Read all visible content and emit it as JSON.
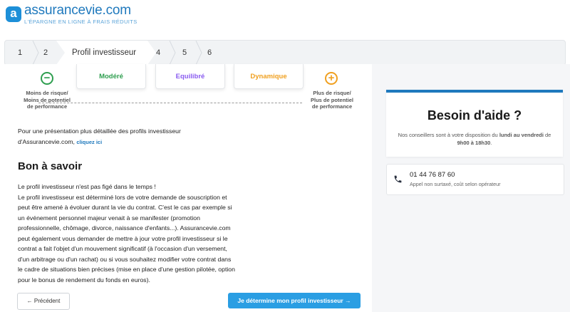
{
  "header": {
    "logo_letter": "a",
    "logo_name": "assurancevie.com",
    "tagline": "L'ÉPARGNE EN LIGNE À FRAIS RÉDUITS"
  },
  "stepper": {
    "steps": [
      "1",
      "2",
      "Profil investisseur",
      "4",
      "5",
      "6"
    ],
    "active_index": 2
  },
  "scale": {
    "left_symbol": "−",
    "left_note": [
      "Moins de risque/",
      "Moins de potentiel",
      "de performance"
    ],
    "right_symbol": "+",
    "right_note": [
      "Plus de risque/",
      "Plus de potentiel",
      "de performance"
    ],
    "profiles": [
      {
        "label": "Modéré",
        "color": "#2e9e4f"
      },
      {
        "label": "Equilibré",
        "color": "#8a5cf0"
      },
      {
        "label": "Dynamique",
        "color": "#f0a020"
      }
    ]
  },
  "intro": {
    "line1": "Pour une présentation plus détaillée des profils investisseur",
    "line2": "d'Assurancevie.com,",
    "link": "cliquez ici"
  },
  "bon_a_savoir": {
    "title": "Bon à savoir",
    "first_line": "Le profil investisseur n'est pas figé dans le temps !",
    "body_lines": [
      "Le profil investisseur est déterminé lors de votre demande de souscription et",
      "peut être amené à évoluer durant la vie du contrat. C'est le cas par exemple si",
      "un événement personnel majeur venait à se manifester (promotion",
      "professionnelle, chômage, divorce, naissance d'enfants...). Assurancevie.com",
      "peut également vous demander de mettre à jour votre profil investisseur si le",
      "contrat a fait l'objet d'un mouvement significatif (à l'occasion d'un versement,",
      "d'un arbitrage ou d'un rachat) ou si vous souhaitez modifier votre contrat dans",
      "le cadre de situations bien précises (mise en place d'une gestion pilotée, option",
      "pour le bonus de rendement du fonds en euros)."
    ]
  },
  "buttons": {
    "prev": "←  Précédent",
    "next": "Je détermine mon profil investisseur  →"
  },
  "help": {
    "title": "Besoin d'aide ?",
    "text_before": "Nos conseillers sont à votre disposition du ",
    "text_bold1": "lundi au vendredi",
    "text_mid": " de ",
    "text_bold2": "9h00 à 18h30",
    "text_end": ".",
    "phone": "01 44 76 87 60",
    "phone_note": "Appel non surtaxé, coût selon opérateur"
  },
  "colors": {
    "accent": "#1f79bd",
    "button": "#2a9ee3",
    "minus": "#2e9e4f",
    "plus": "#f0a020"
  }
}
